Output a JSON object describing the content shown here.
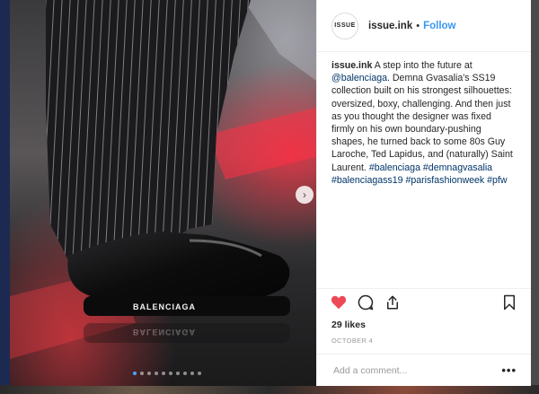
{
  "post": {
    "avatar_text": "ISSUE",
    "username": "issue.ink",
    "separator": "•",
    "follow_label": "Follow",
    "caption": {
      "user": "issue.ink",
      "mention": "@balenciaga",
      "text": ". Demna Gvasalia's SS19 collection built on his strongest silhouettes: oversized, boxy, challenging. And then just as you thought the designer was fixed firmly on his own boundary-pushing shapes, he turned back to some 80s Guy Laroche, Ted Lapidus, and (naturally) Saint Laurent.",
      "intro": "A step into the future at",
      "hashtags": "#balenciaga #demnagvasalia #balenciagass19 #parisfashionweek #pfw"
    },
    "likes": "29 likes",
    "date": "OCTOBER 4",
    "comment_placeholder": "Add a comment...",
    "more_label": "•••"
  },
  "photo": {
    "brand_text": "BALENCIAGA",
    "dot_count": 10,
    "active_dot": 0,
    "next_arrow": "›"
  },
  "icons": {
    "like": "heart-icon",
    "comment": "comment-icon",
    "share": "share-icon",
    "save": "bookmark-icon"
  },
  "colors": {
    "like": "#ed4956",
    "follow": "#3897f0",
    "link": "#003569"
  }
}
